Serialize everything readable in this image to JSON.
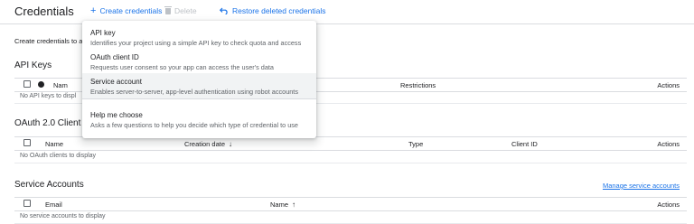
{
  "header": {
    "title": "Credentials",
    "create_label": "Create credentials",
    "delete_label": "Delete",
    "restore_label": "Restore deleted credentials"
  },
  "intro_text": "Create credentials to a",
  "api_keys": {
    "title": "API Keys",
    "columns": {
      "name": "Nam",
      "restrictions": "Restrictions",
      "actions": "Actions"
    },
    "empty": "No API keys to displ"
  },
  "oauth": {
    "title": "OAuth 2.0 Client I",
    "columns": {
      "name": "Name",
      "creation_date": "Creation date",
      "type": "Type",
      "client_id": "Client ID",
      "actions": "Actions"
    },
    "empty": "No OAuth clients to display"
  },
  "service_accounts": {
    "title": "Service Accounts",
    "manage_link": "Manage service accounts",
    "columns": {
      "email": "Email",
      "name": "Name",
      "actions": "Actions"
    },
    "empty": "No service accounts to display"
  },
  "menu": {
    "items": [
      {
        "title": "API key",
        "description": "Identifies your project using a simple API key to check quota and access"
      },
      {
        "title": "OAuth client ID",
        "description": "Requests user consent so your app can access the user's data"
      },
      {
        "title": "Service account",
        "description": "Enables server-to-server, app-level authentication using robot accounts"
      },
      {
        "title": "Help me choose",
        "description": "Asks a few questions to help you decide which type of credential to use"
      }
    ],
    "highlighted_index": 2
  },
  "colors": {
    "accent": "#1a73e8",
    "text": "#202124",
    "muted": "#5f6368",
    "divider": "#dadce0"
  }
}
